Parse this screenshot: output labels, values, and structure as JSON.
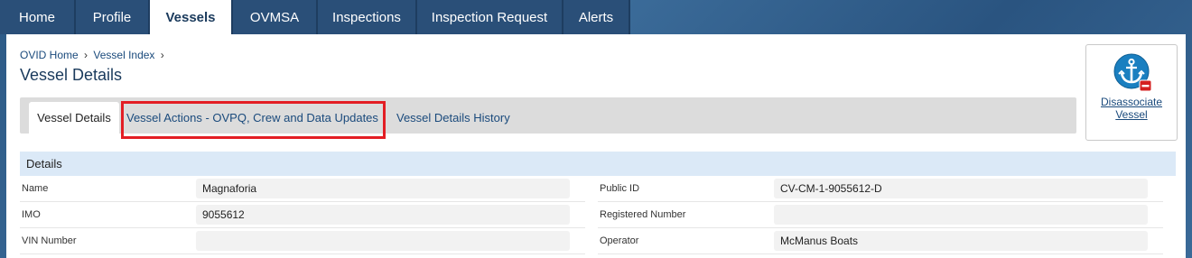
{
  "topnav": {
    "tabs": [
      {
        "label": "Home"
      },
      {
        "label": "Profile"
      },
      {
        "label": "Vessels"
      },
      {
        "label": "OVMSA"
      },
      {
        "label": "Inspections"
      },
      {
        "label": "Inspection Request"
      },
      {
        "label": "Alerts"
      }
    ],
    "active": "Vessels"
  },
  "breadcrumb": {
    "items": [
      "OVID Home",
      "Vessel Index"
    ],
    "separator": "›"
  },
  "page": {
    "title": "Vessel Details"
  },
  "action": {
    "label_line1": "Disassociate",
    "label_line2": "Vessel",
    "icon": "anchor-remove-icon"
  },
  "subtabs": [
    {
      "label": "Vessel Details"
    },
    {
      "label": "Vessel Actions - OVPQ, Crew and Data Updates"
    },
    {
      "label": "Vessel Details History"
    }
  ],
  "details": {
    "header": "Details",
    "left": [
      {
        "label": "Name",
        "value": "Magnaforia"
      },
      {
        "label": "IMO",
        "value": "9055612"
      },
      {
        "label": "VIN Number",
        "value": ""
      }
    ],
    "right": [
      {
        "label": "Public ID",
        "value": "CV-CM-1-9055612-D"
      },
      {
        "label": "Registered Number",
        "value": ""
      },
      {
        "label": "Operator",
        "value": "McManus Boats"
      }
    ]
  },
  "colors": {
    "highlight": "#e31e24",
    "nav_bg": "#2a4f78",
    "section_header_bg": "#dbe9f7"
  }
}
